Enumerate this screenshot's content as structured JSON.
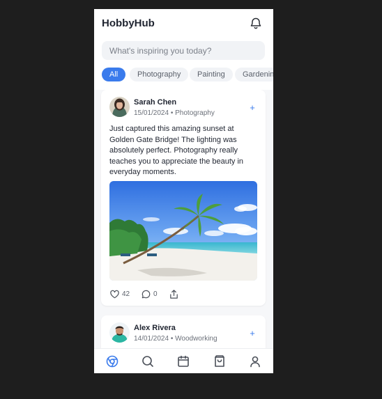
{
  "app": {
    "title": "HobbyHub"
  },
  "search": {
    "placeholder": "What's inspiring you today?"
  },
  "filters": [
    {
      "label": "All",
      "active": true
    },
    {
      "label": "Photography",
      "active": false
    },
    {
      "label": "Painting",
      "active": false
    },
    {
      "label": "Gardening",
      "active": false
    }
  ],
  "posts": [
    {
      "author": "Sarah Chen",
      "date": "15/01/2024",
      "category": "Photography",
      "separator": "•",
      "text": "Just captured this amazing sunset at Golden Gate Bridge! The lighting was absolutely perfect. Photography really teaches you to appreciate the beauty in everyday moments.",
      "likes": "42",
      "comments": "0",
      "follow_label": "+"
    },
    {
      "author": "Alex Rivera",
      "date": "14/01/2024",
      "category": "Woodworking",
      "separator": "•",
      "follow_label": "+"
    }
  ],
  "colors": {
    "accent": "#3a7bec",
    "background": "#1e1e1e",
    "surface": "#ffffff"
  },
  "icons": {
    "header": "bell-icon",
    "nav": [
      "home-icon",
      "search-icon",
      "calendar-icon",
      "shopping-bag-icon",
      "profile-icon"
    ],
    "actions": [
      "heart-icon",
      "comment-icon",
      "share-icon"
    ]
  }
}
